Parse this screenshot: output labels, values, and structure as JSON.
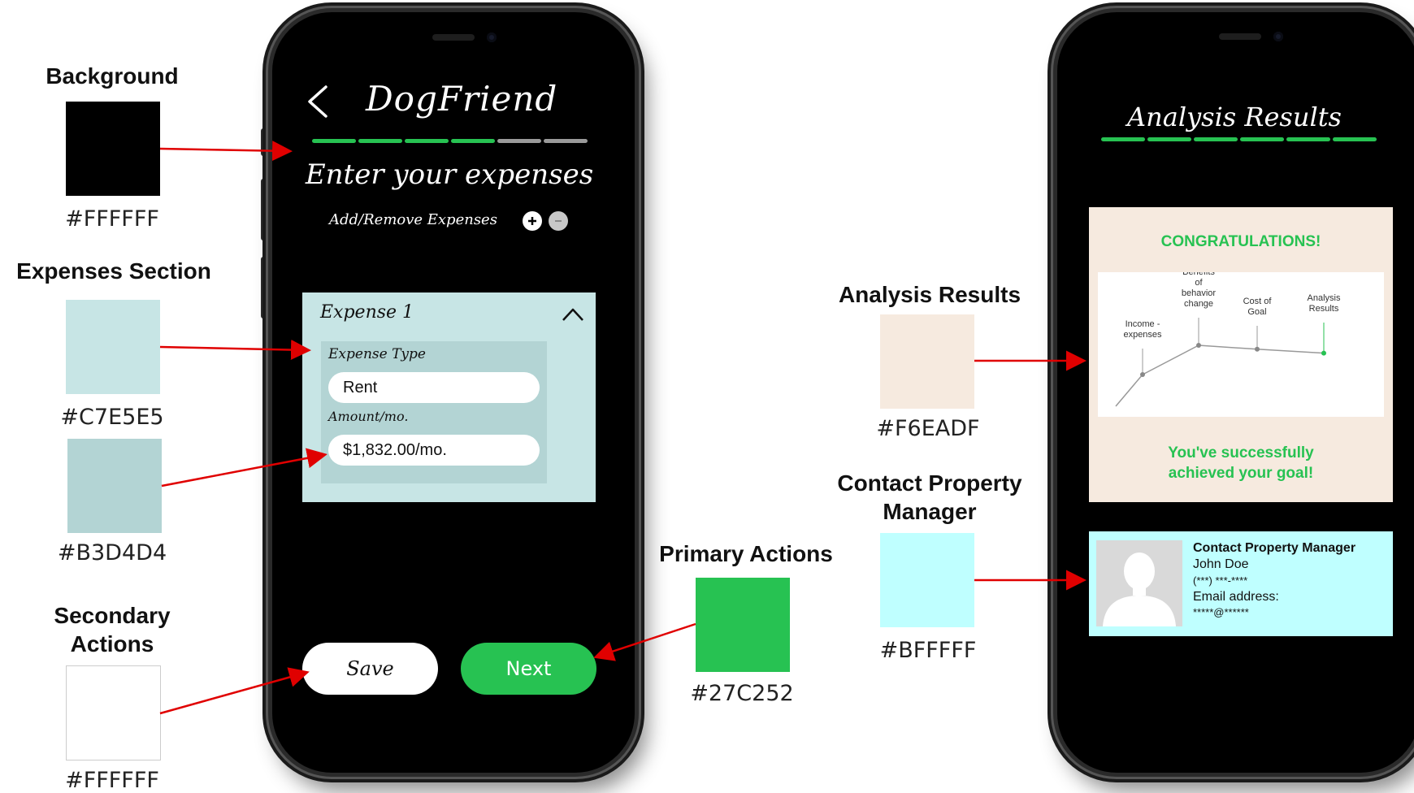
{
  "legend": {
    "background": {
      "title": "Background",
      "hex": "#FFFFFF",
      "swatch": "#000000"
    },
    "expenses_section": {
      "title": "Expenses Section",
      "hex_1": "#C7E5E5",
      "swatch_1": "#C7E5E5",
      "hex_2": "#B3D4D4",
      "swatch_2": "#B3D4D4"
    },
    "secondary_actions": {
      "title": "Secondary Actions",
      "hex": "#FFFFFF",
      "swatch": "#FFFFFF"
    },
    "primary_actions": {
      "title": "Primary Actions",
      "hex": "#27C252",
      "swatch": "#27C252"
    },
    "analysis_results": {
      "title": "Analysis Results",
      "hex": "#F6EADF",
      "swatch": "#F6EADF"
    },
    "contact_manager": {
      "title": "Contact Property Manager",
      "hex": "#BFFFFF",
      "swatch": "#BFFFFF"
    }
  },
  "screen1": {
    "app_title": "DogFriend",
    "back_icon": "chevron-left-icon",
    "progress": {
      "total_steps": 6,
      "completed_steps": 4
    },
    "heading": "Enter your expenses",
    "add_remove_label": "Add/Remove Expenses",
    "expense_card": {
      "title": "Expense 1",
      "type_label": "Expense Type",
      "type_value": "Rent",
      "amount_label": "Amount/mo.",
      "amount_value": "$1,832.00/mo."
    },
    "save_label": "Save",
    "next_label": "Next"
  },
  "screen2": {
    "title": "Analysis Results",
    "progress": {
      "total_steps": 6,
      "completed_steps": 6
    },
    "congrats": "CONGRATULATIONS!",
    "steps": [
      {
        "label": "Income - expenses",
        "value": 2
      },
      {
        "label": "Benefits of behavior change",
        "value": 5
      },
      {
        "label": "Cost of Goal",
        "value": 4.6
      },
      {
        "label": "Analysis Results",
        "value": 4.2
      }
    ],
    "success": "You've successfully achieved your goal!",
    "contact": {
      "heading": "Contact Property Manager",
      "name": "John Doe",
      "phone": "(***) ***-****",
      "email_label": "Email address:",
      "email_value": "*****@******"
    }
  },
  "colors": {
    "accent": "#27C252",
    "arrow": "#E00000",
    "inactive": "#9A9A9A"
  }
}
